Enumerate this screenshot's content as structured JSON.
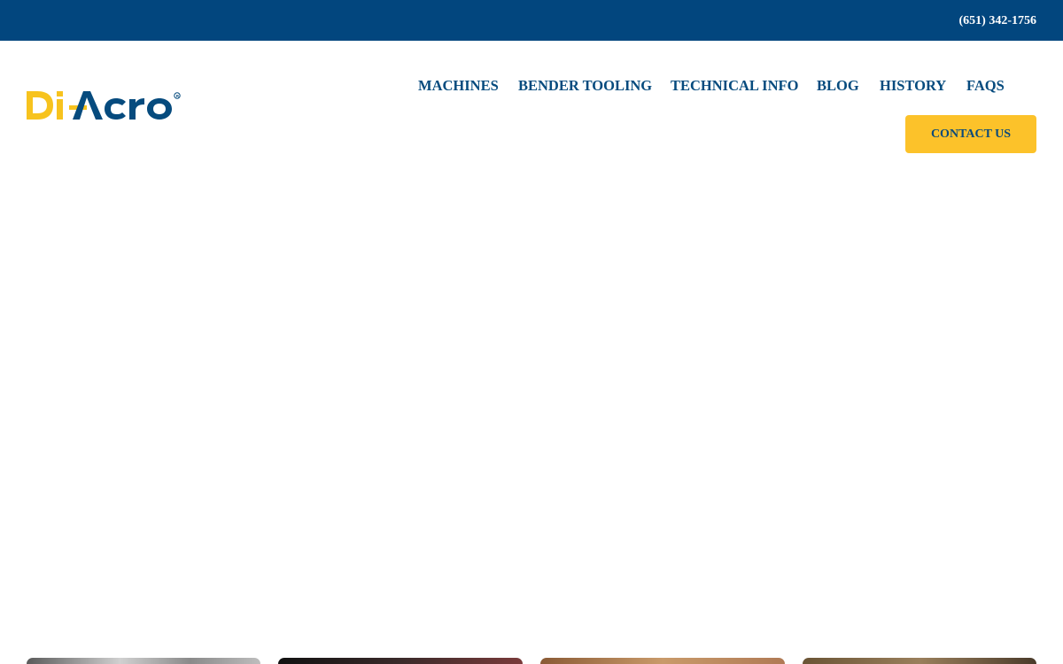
{
  "topbar": {
    "phone": "(651) 342-1756",
    "background_color": "#02467e"
  },
  "logo": {
    "text_part_1": "Di",
    "text_part_2": "Acro",
    "registered_mark": "®",
    "colors": {
      "yellow": "#f7c31e",
      "blue": "#064b7e"
    }
  },
  "nav": {
    "items": [
      {
        "label": "MACHINES"
      },
      {
        "label": "BENDER TOOLING"
      },
      {
        "label": "TECHNICAL INFO"
      },
      {
        "label": "BLOG"
      },
      {
        "label": "HISTORY"
      },
      {
        "label": "FAQS"
      }
    ],
    "color": "#064b7e"
  },
  "cta": {
    "label": "CONTACT US",
    "background_color": "#fcc22a"
  },
  "cards": {
    "count_visible": 4
  }
}
